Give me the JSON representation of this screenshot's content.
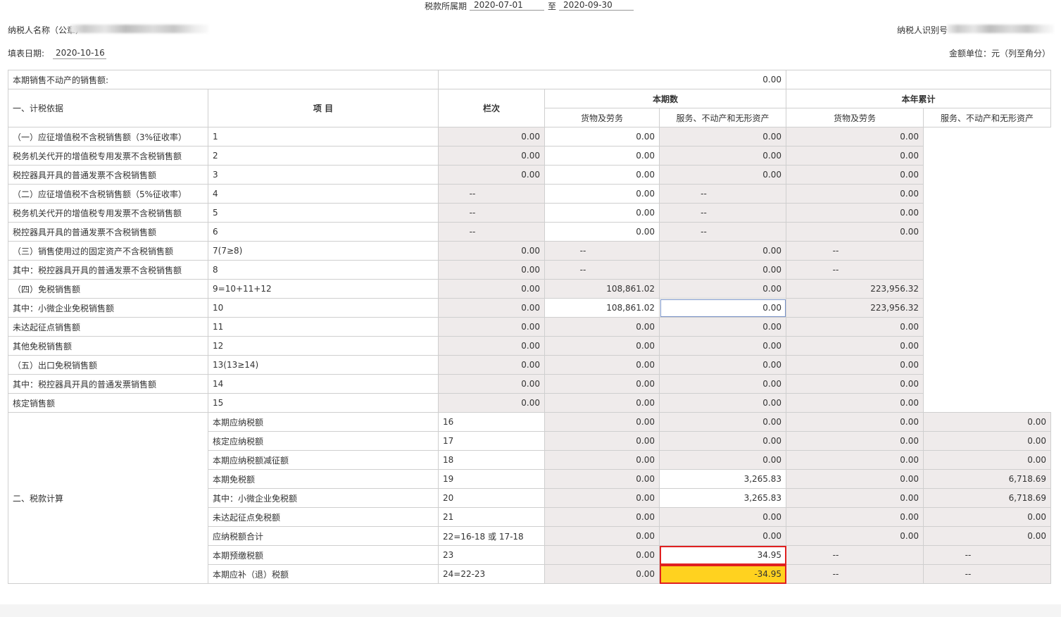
{
  "header": {
    "period_label": "税款所属期",
    "period_start": "2020-07-01",
    "to_label": "至",
    "period_end": "2020-09-30",
    "taxpayer_name_label": "纳税人名称（公章）",
    "taxpayer_id_label": "纳税人识别号",
    "fill_date_label": "填表日期:",
    "fill_date": "2020-10-16",
    "unit_label": "金额单位：元（列至角分）"
  },
  "table": {
    "top_row_label": "本期销售不动产的销售额:",
    "top_row_value": "0.00",
    "col_item": "项  目",
    "col_line": "栏次",
    "group_current": "本期数",
    "group_year": "本年累计",
    "sub_goods": "货物及劳务",
    "sub_service": "服务、不动产和无形资产",
    "section1": "一、计税依据",
    "section2": "二、税款计算",
    "rows": [
      {
        "item": "（一）应征增值税不含税销售额（3%征收率）",
        "line": "1",
        "c1": "0.00",
        "c2": "0.00",
        "c3": "0.00",
        "c4": "0.00"
      },
      {
        "item": " 税务机关代开的增值税专用发票不含税销售额",
        "line": "2",
        "c1": "0.00",
        "c2": "0.00",
        "c3": "0.00",
        "c4": "0.00"
      },
      {
        "item": "税控器具开具的普通发票不含税销售额",
        "line": "3",
        "c1": "0.00",
        "c2": "0.00",
        "c3": "0.00",
        "c4": "0.00"
      },
      {
        "item": "（二）应征增值税不含税销售额（5%征收率）",
        "line": "4",
        "c1": "--",
        "c2": "0.00",
        "c3": "--",
        "c4": "0.00"
      },
      {
        "item": "税务机关代开的增值税专用发票不含税销售额",
        "line": "5",
        "c1": "--",
        "c2": "0.00",
        "c3": "--",
        "c4": "0.00"
      },
      {
        "item": "税控器具开具的普通发票不含税销售额",
        "line": "6",
        "c1": "--",
        "c2": "0.00",
        "c3": "--",
        "c4": "0.00"
      },
      {
        "item": "（三）销售使用过的固定资产不含税销售额",
        "line": "7(7≥8)",
        "c1": "0.00",
        "c2": "--",
        "c3": "0.00",
        "c4": "--"
      },
      {
        "item": "其中：税控器具开具的普通发票不含税销售额",
        "line": "8",
        "c1": "0.00",
        "c2": "--",
        "c3": "0.00",
        "c4": "--"
      },
      {
        "item": "（四）免税销售额",
        "line": "9=10+11+12",
        "c1": "0.00",
        "c2": "108,861.02",
        "c3": "0.00",
        "c4": "223,956.32"
      },
      {
        "item": "其中：小微企业免税销售额",
        "line": "10",
        "c1": "0.00",
        "c2": "108,861.02",
        "c3": "0.00",
        "c4": "223,956.32"
      },
      {
        "item": "未达起征点销售额",
        "line": "11",
        "c1": "0.00",
        "c2": "0.00",
        "c3": "0.00",
        "c4": "0.00"
      },
      {
        "item": "其他免税销售额",
        "line": "12",
        "c1": "0.00",
        "c2": "0.00",
        "c3": "0.00",
        "c4": "0.00"
      },
      {
        "item": "（五）出口免税销售额",
        "line": "13(13≥14)",
        "c1": "0.00",
        "c2": "0.00",
        "c3": "0.00",
        "c4": "0.00"
      },
      {
        "item": "其中：税控器具开具的普通发票销售额",
        "line": "14",
        "c1": "0.00",
        "c2": "0.00",
        "c3": "0.00",
        "c4": "0.00"
      },
      {
        "item": "核定销售额",
        "line": "15",
        "c1": "0.00",
        "c2": "0.00",
        "c3": "0.00",
        "c4": "0.00"
      },
      {
        "item": "本期应纳税额",
        "line": "16",
        "c1": "0.00",
        "c2": "0.00",
        "c3": "0.00",
        "c4": "0.00"
      },
      {
        "item": "核定应纳税额",
        "line": "17",
        "c1": "0.00",
        "c2": "0.00",
        "c3": "0.00",
        "c4": "0.00"
      },
      {
        "item": "本期应纳税额减征额",
        "line": "18",
        "c1": "0.00",
        "c2": "0.00",
        "c3": "0.00",
        "c4": "0.00"
      },
      {
        "item": "本期免税额",
        "line": "19",
        "c1": "0.00",
        "c2": "3,265.83",
        "c3": "0.00",
        "c4": "6,718.69"
      },
      {
        "item": "其中：小微企业免税额",
        "line": "20",
        "c1": "0.00",
        "c2": "3,265.83",
        "c3": "0.00",
        "c4": "6,718.69"
      },
      {
        "item": "未达起征点免税额",
        "line": "21",
        "c1": "0.00",
        "c2": "0.00",
        "c3": "0.00",
        "c4": "0.00"
      },
      {
        "item": "应纳税额合计",
        "line": "22=16-18 或 17-18",
        "c1": "0.00",
        "c2": "0.00",
        "c3": "0.00",
        "c4": "0.00"
      },
      {
        "item": "本期预缴税额",
        "line": "23",
        "c1": "0.00",
        "c2": "34.95",
        "c3": "--",
        "c4": "--"
      },
      {
        "item": "本期应补（退）税额",
        "line": "24=22-23",
        "c1": "0.00",
        "c2": "-34.95",
        "c3": "--",
        "c4": "--"
      }
    ]
  },
  "colors": {
    "readonly_bg": "#efebeb",
    "highlight_yellow": "#ffd21f",
    "red_border": "#e02020"
  }
}
